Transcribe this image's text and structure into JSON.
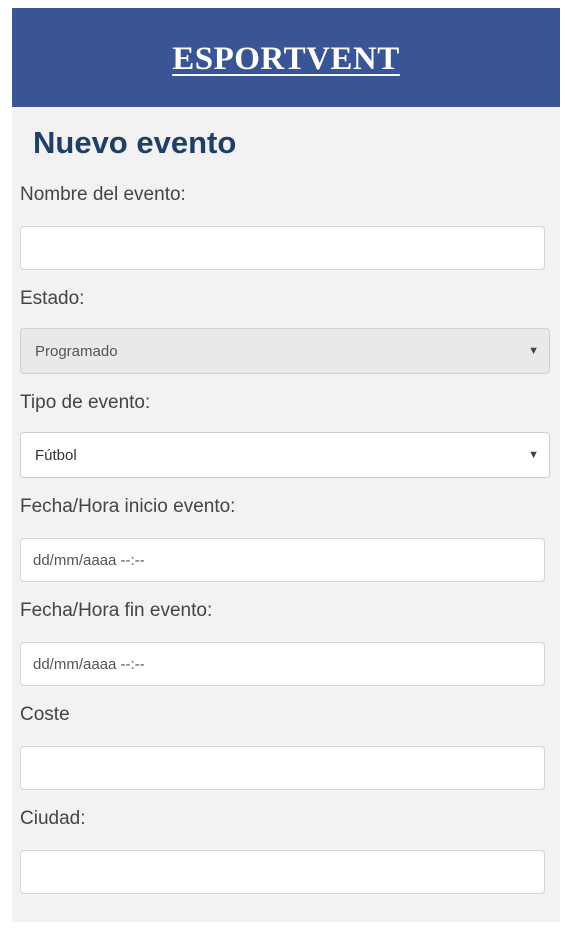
{
  "header": {
    "brand": "ESPORTVENT"
  },
  "page": {
    "title": "Nuevo evento"
  },
  "form": {
    "nombre": {
      "label": "Nombre del evento:",
      "value": "",
      "placeholder": ""
    },
    "estado": {
      "label": "Estado:",
      "selected": "Programado"
    },
    "tipo": {
      "label": "Tipo de evento:",
      "selected": "Fútbol"
    },
    "inicio": {
      "label": "Fecha/Hora inicio evento:",
      "placeholder": "dd/mm/aaaa --:--"
    },
    "fin": {
      "label": "Fecha/Hora fin evento:",
      "placeholder": "dd/mm/aaaa --:--"
    },
    "coste": {
      "label": "Coste",
      "value": "",
      "placeholder": ""
    },
    "ciudad": {
      "label": "Ciudad:",
      "value": "",
      "placeholder": ""
    }
  },
  "icons": {
    "dropdown": "chevron-down-icon"
  },
  "colors": {
    "header_bg": "#3a5595",
    "title": "#1f3f66",
    "page_bg": "#f2f2f2"
  }
}
